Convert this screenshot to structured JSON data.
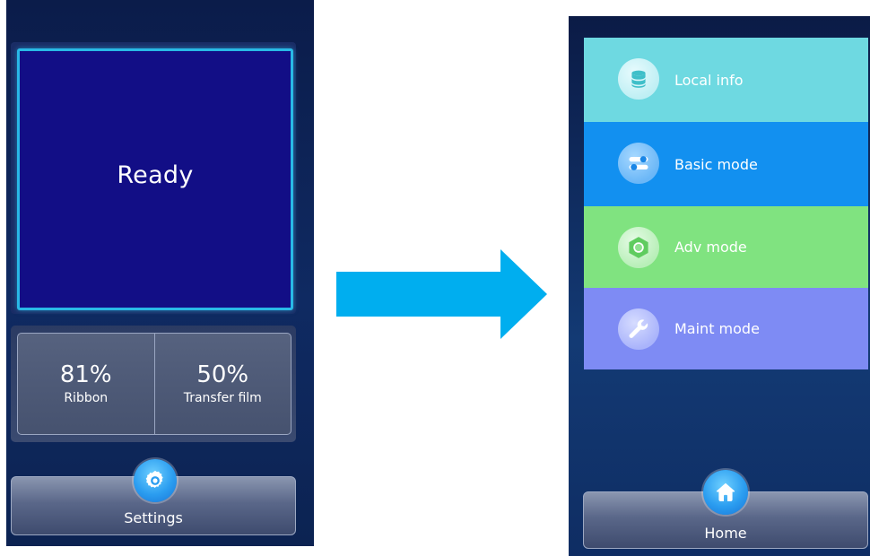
{
  "left_screen": {
    "status": "Ready",
    "levels": [
      {
        "value": "81%",
        "label": "Ribbon"
      },
      {
        "value": "50%",
        "label": "Transfer film"
      }
    ],
    "bottom_bar": {
      "label": "Settings",
      "icon": "gear-icon"
    }
  },
  "transition": {
    "icon": "arrow-right-icon",
    "color": "#00aeef"
  },
  "right_screen": {
    "menu": [
      {
        "label": "Local info",
        "icon": "database-icon",
        "color": "#6ed9e1"
      },
      {
        "label": "Basic mode",
        "icon": "toggle-switches-icon",
        "color": "#1290f0"
      },
      {
        "label": "Adv mode",
        "icon": "hex-nut-icon",
        "color": "#80e380"
      },
      {
        "label": "Maint mode",
        "icon": "wrench-icon",
        "color": "#7e8bf4"
      }
    ],
    "bottom_bar": {
      "label": "Home",
      "icon": "home-icon"
    }
  },
  "colors": {
    "status_panel_bg": "#120e86",
    "status_panel_border": "#29b9e6",
    "button_blue": "#2b9df0"
  }
}
